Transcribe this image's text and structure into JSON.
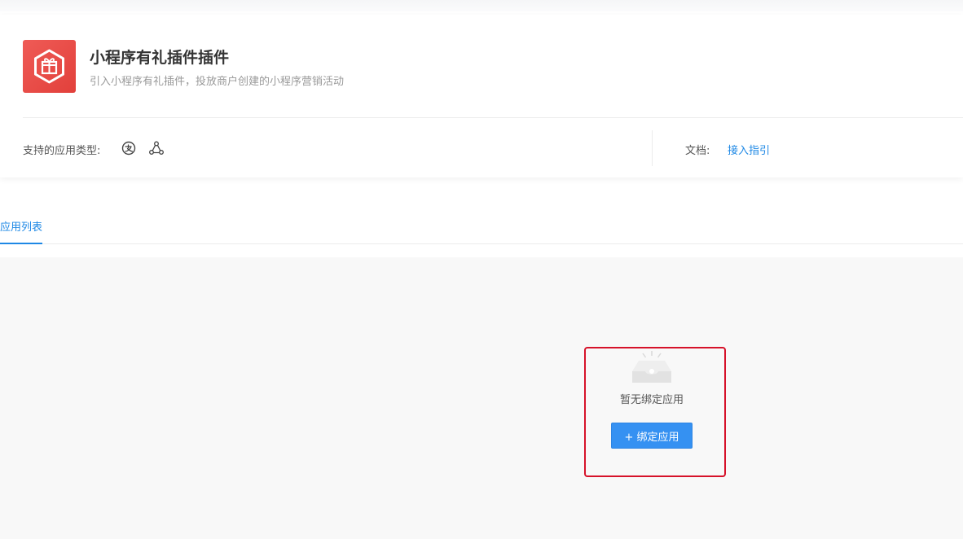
{
  "plugin": {
    "title": "小程序有礼插件插件",
    "description": "引入小程序有礼插件，投放商户创建的小程序营销活动",
    "logo_icon": "gift-box-icon",
    "logo_color": "#e84a45"
  },
  "support": {
    "label": "支持的应用类型:",
    "app_types": [
      {
        "icon": "alipay-miniapp-icon"
      },
      {
        "icon": "taobao-miniapp-icon"
      }
    ]
  },
  "docs": {
    "label": "文档:",
    "link_label": "接入指引"
  },
  "tabs": [
    {
      "label": "应用列表",
      "active": true
    }
  ],
  "empty_state": {
    "icon": "empty-inbox-icon",
    "message": "暂无绑定应用",
    "button_label": "+ 绑定应用"
  },
  "colors": {
    "accent": "#1e88e5",
    "button": "#3591f2",
    "highlight": "#d6122a"
  }
}
